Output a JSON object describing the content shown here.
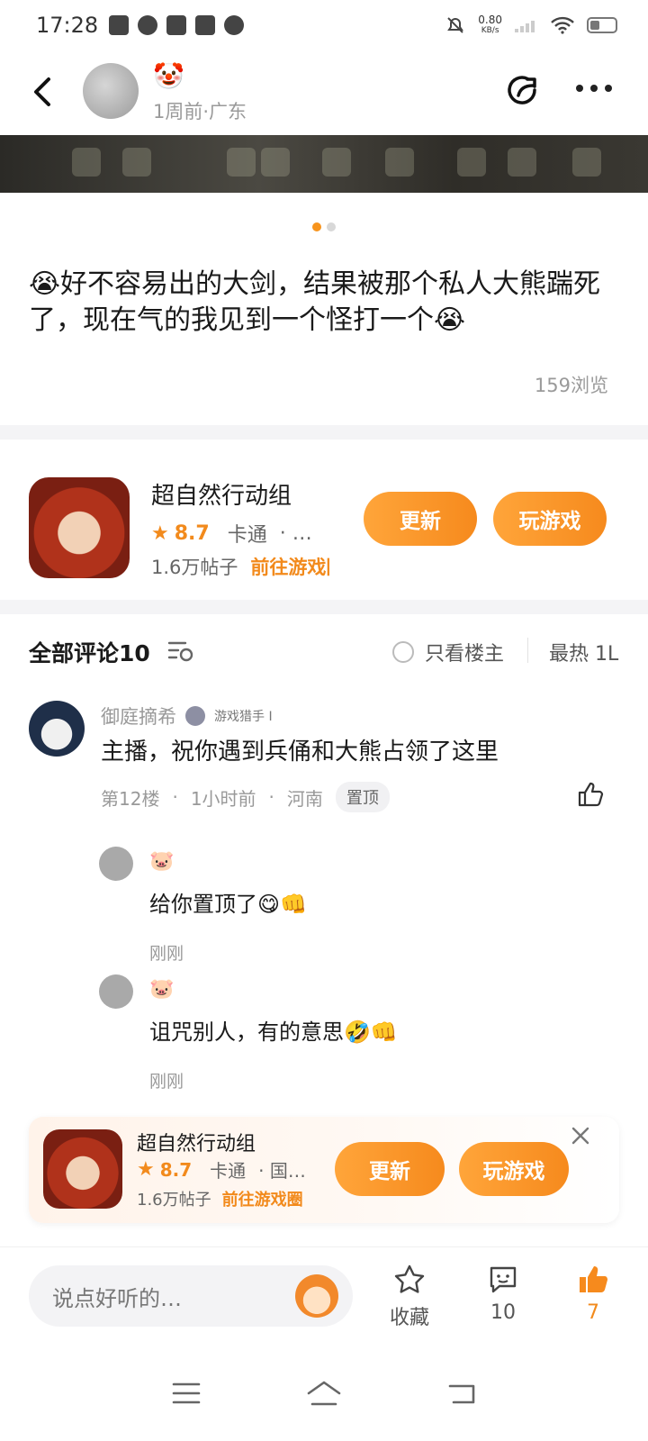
{
  "status_bar": {
    "time": "17:28",
    "net_speed_value": "0.80",
    "net_speed_unit": "KB/s"
  },
  "post": {
    "author_emoji": "🤡",
    "meta": "1周前·广东",
    "text": "😭好不容易出的大剑，结果被那个私人大熊踹死了，现在气的我见到一个怪打一个😭",
    "views": "159浏览",
    "image_count": 2,
    "current_image": 1
  },
  "game": {
    "name": "超自然行动组",
    "rating": "8.7",
    "tag": "卡通",
    "tag_more": "· …",
    "posts": "1.6万帖子",
    "goto": "前往游戏圈",
    "update_label": "更新",
    "play_label": "玩游戏"
  },
  "comments_header": {
    "title": "全部评论10",
    "only_op": "只看楼主",
    "sort": "最热 1L"
  },
  "comment": {
    "username": "御庭摘希",
    "badge": "游戏猎手 I",
    "body": "主播，祝你遇到兵俑和大熊占领了这里",
    "floor": "第12楼",
    "time": "1小时前",
    "location": "河南",
    "pin_label": "置顶",
    "replies": [
      {
        "name_emoji": "🐷",
        "body": "给你置顶了😋👊",
        "time": "刚刚"
      },
      {
        "name_emoji": "🐷",
        "body": "诅咒别人，有的意思🤣👊",
        "time": "刚刚"
      }
    ]
  },
  "floating_card": {
    "name": "超自然行动组",
    "rating": "8.7",
    "tag": "卡通",
    "tag_more": "· 国…",
    "posts": "1.6万帖子",
    "goto": "前往游戏圈",
    "update_label": "更新",
    "play_label": "玩游戏"
  },
  "bottom_bar": {
    "input_placeholder": "说点好听的…",
    "favorite_label": "收藏",
    "comment_count": "10",
    "like_count": "7"
  },
  "colors": {
    "accent": "#f68a1d",
    "text": "#1a1a1a",
    "muted": "#999999"
  }
}
